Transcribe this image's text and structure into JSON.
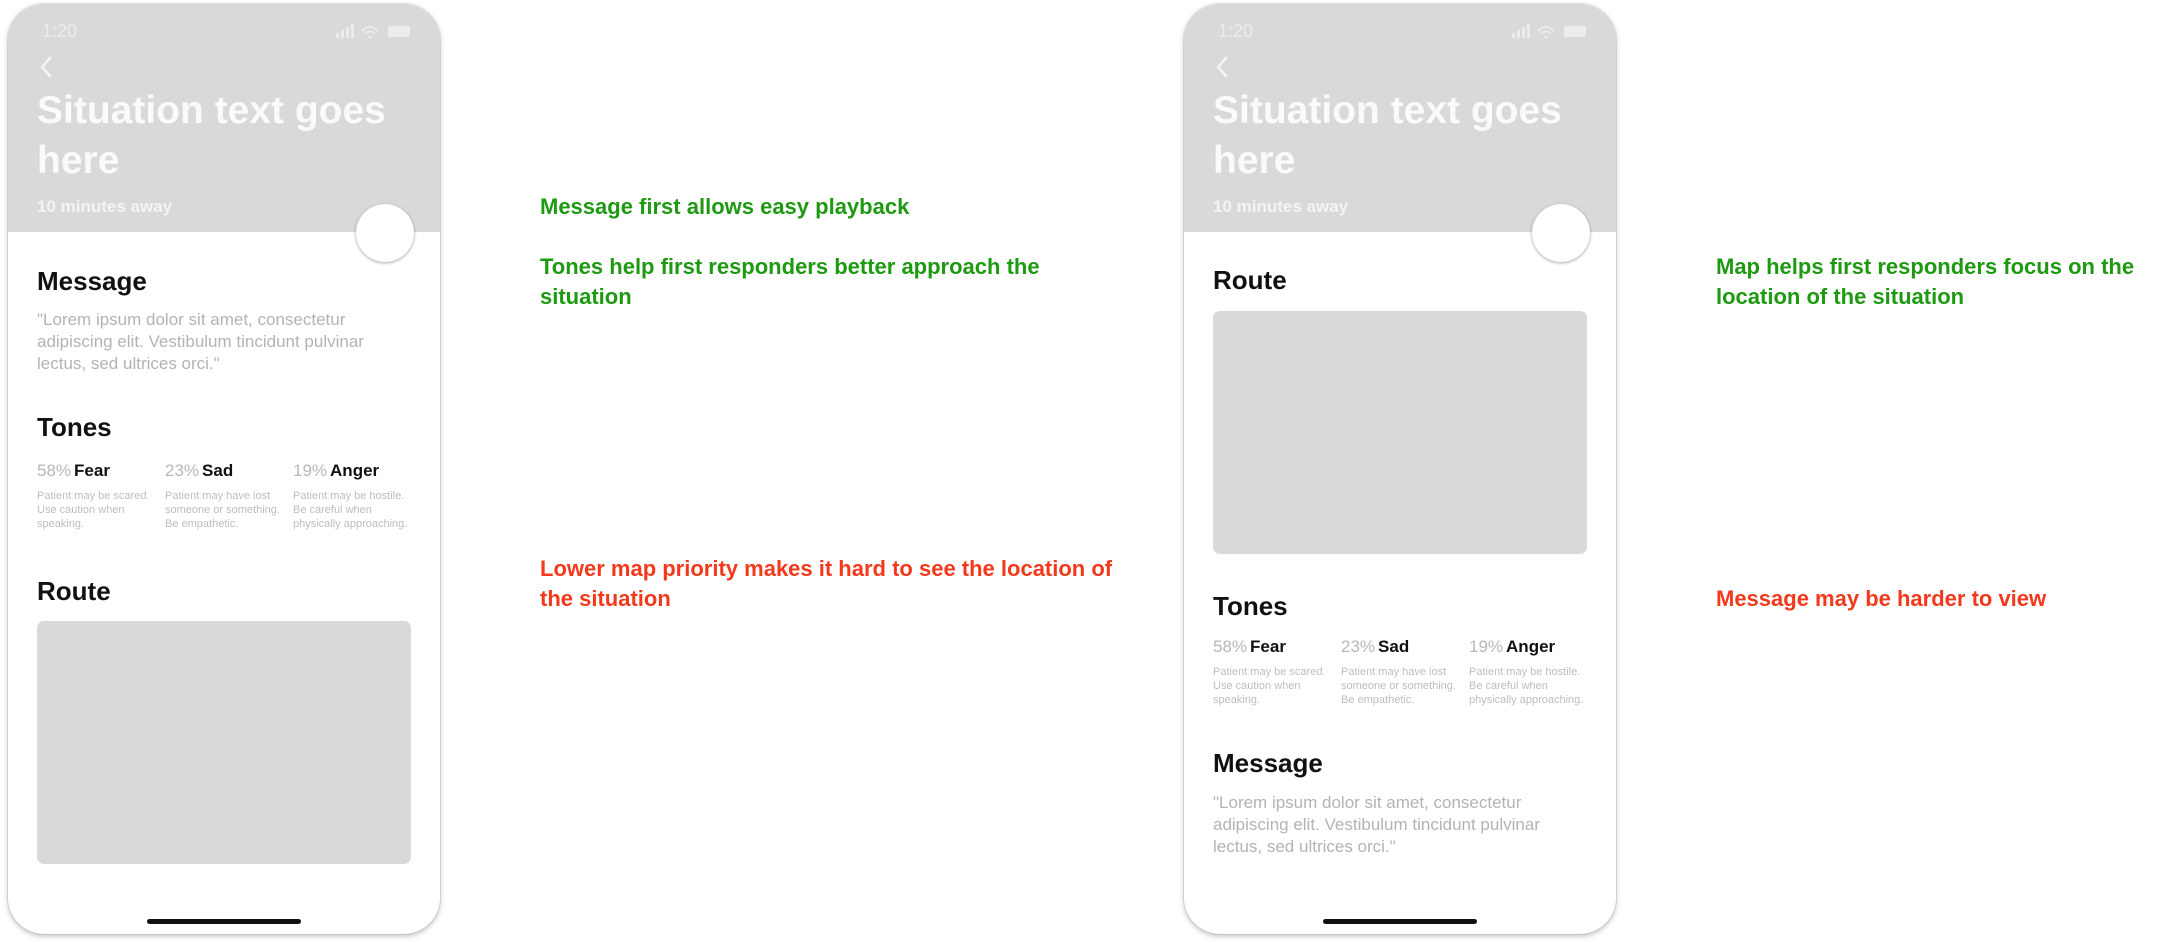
{
  "colors": {
    "positive": "#1e9a12",
    "negative": "#f2391c",
    "placeholder": "#d9d9d9"
  },
  "screens": [
    {
      "status_time": "1:20",
      "title": "Situation text goes here",
      "subtitle": "10 minutes away",
      "message": {
        "heading": "Message",
        "text": "\"Lorem ipsum dolor sit amet, consectetur adipiscing elit. Vestibulum tincidunt pulvinar lectus, sed ultrices orci.\""
      },
      "tones": {
        "heading": "Tones",
        "items": [
          {
            "percent": "58%",
            "label": "Fear",
            "description": "Patient may be scared. Use caution when speaking."
          },
          {
            "percent": "23%",
            "label": "Sad",
            "description": "Patient may have lost someone or something. Be empathetic."
          },
          {
            "percent": "19%",
            "label": "Anger",
            "description": "Patient may be hostile. Be careful when physically approaching."
          }
        ]
      },
      "route": {
        "heading": "Route"
      }
    },
    {
      "status_time": "1:20",
      "title": "Situation text goes here",
      "subtitle": "10 minutes away",
      "route": {
        "heading": "Route"
      },
      "tones": {
        "heading": "Tones",
        "items": [
          {
            "percent": "58%",
            "label": "Fear",
            "description": "Patient may be scared. Use caution when speaking."
          },
          {
            "percent": "23%",
            "label": "Sad",
            "description": "Patient may have lost someone or something. Be empathetic."
          },
          {
            "percent": "19%",
            "label": "Anger",
            "description": "Patient may be hostile. Be careful when physically approaching."
          }
        ]
      },
      "message": {
        "heading": "Message",
        "text": "\"Lorem ipsum dolor sit amet, consectetur adipiscing elit. Vestibulum tincidunt pulvinar lectus, sed ultrices orci.\""
      }
    }
  ],
  "annotations": {
    "a_pro_1": "Message first allows easy playback",
    "a_pro_2": "Tones help first responders better approach the situation",
    "a_con_1": "Lower map priority makes it hard to see the location of the situation",
    "b_pro_1": "Map helps first responders focus on the location of the situation",
    "b_con_1": "Message may be harder to view"
  }
}
